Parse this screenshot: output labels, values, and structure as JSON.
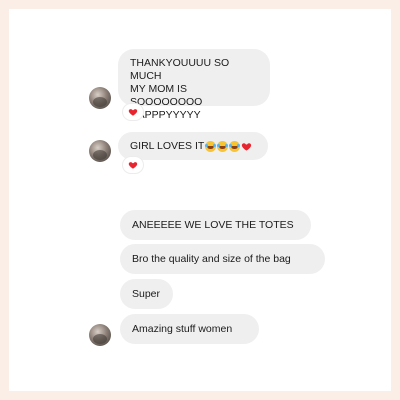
{
  "conversation": {
    "messages": [
      {
        "text": "THANKYOUUUU SO MUCH\nMY MOM IS SOOOOOOOO\nHAPPPYYYYY",
        "reaction": "heart-icon"
      },
      {
        "text": "GIRL LOVES IT",
        "emojis": [
          "laughing-crying-icon",
          "laughing-crying-icon",
          "laughing-crying-icon",
          "heart-icon"
        ],
        "reaction": "heart-icon"
      },
      {
        "text": "ANEEEEE WE LOVE THE TOTES"
      },
      {
        "text": "Bro the quality and size of the bag"
      },
      {
        "text": "Super"
      },
      {
        "text": "Amazing stuff women"
      }
    ]
  },
  "colors": {
    "page_background": "#fbeee6",
    "bubble_background": "#efefef",
    "heart": "#e8252f"
  }
}
